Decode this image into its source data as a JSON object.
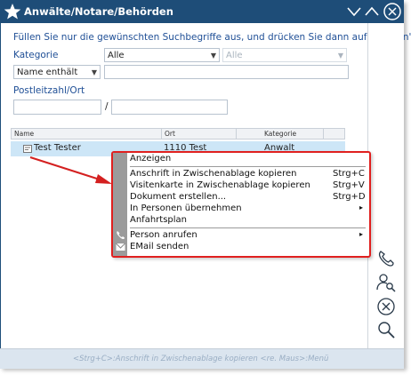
{
  "window": {
    "title": "Anwälte/Notare/Behörden",
    "controls": {
      "minimize": "collapse",
      "maximize": "expand",
      "close": "close"
    }
  },
  "form": {
    "hint": "Füllen Sie nur die gewünschten Suchbegriffe aus, und drücken Sie dann auf \"Suchen\".",
    "kategorie_label": "Kategorie",
    "kategorie_value": "Alle",
    "kategorie2_value": "Alle",
    "name_mode_value": "Name enthält",
    "name_value": "",
    "plz_label": "Postleitzahl/Ort",
    "plz_value": "",
    "plz_separator": "/",
    "ort_value": ""
  },
  "table": {
    "columns": [
      "Name",
      "Ort",
      "Kategorie"
    ],
    "rows": [
      {
        "name": "Test Tester",
        "ort": "1110 Test",
        "kategorie": "Anwalt"
      }
    ]
  },
  "context_menu": {
    "items": [
      {
        "label": "Anzeigen",
        "shortcut": ""
      },
      {
        "label": "Anschrift in Zwischenablage kopieren",
        "shortcut": "Strg+C"
      },
      {
        "label": "Visitenkarte in Zwischenablage kopieren",
        "shortcut": "Strg+V"
      },
      {
        "label": "Dokument erstellen...",
        "shortcut": "Strg+D"
      },
      {
        "label": "In Personen übernehmen",
        "shortcut": "▸"
      },
      {
        "label": "Anfahrtsplan",
        "shortcut": ""
      },
      {
        "label": "Person anrufen",
        "shortcut": "▸"
      },
      {
        "label": "EMail senden",
        "shortcut": ""
      }
    ]
  },
  "rightbar": {
    "icons": [
      "phone-icon",
      "person-search-icon",
      "close-circle-icon",
      "search-icon"
    ]
  },
  "statusbar": {
    "text": "<Strg+C>:Anschrift in Zwischenablage kopieren   <re. Maus>:Menü"
  },
  "colors": {
    "titlebar": "#1e4d78",
    "label_blue": "#1f4f96",
    "selection": "#cde6f7",
    "menu_border": "#e0201f",
    "arrow": "#d42020"
  }
}
